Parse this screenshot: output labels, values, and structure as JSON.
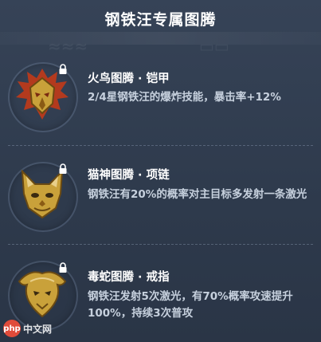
{
  "title": "钢铁汪专属图腾",
  "totems": [
    {
      "name": "火鸟图腾 · 铠甲",
      "desc": "2/4星钢铁汪的爆炸技能，暴击率+12%",
      "icon": "firebird-totem-icon",
      "locked": true
    },
    {
      "name": "猫神图腾 · 项链",
      "desc": "钢铁汪有20%的概率对主目标多发射一条激光",
      "icon": "catgod-totem-icon",
      "locked": true
    },
    {
      "name": "毒蛇图腾 · 戒指",
      "desc": "钢铁汪发射5次激光，有70%概率攻速提升100%，持续3次普攻",
      "icon": "viper-totem-icon",
      "locked": true
    }
  ],
  "watermark": {
    "logo": "php",
    "text": "中文网"
  },
  "colors": {
    "background": "#2f3b4e",
    "gold": "#c9a13a",
    "text": "#ffffff",
    "desc": "#c6d0dd"
  }
}
